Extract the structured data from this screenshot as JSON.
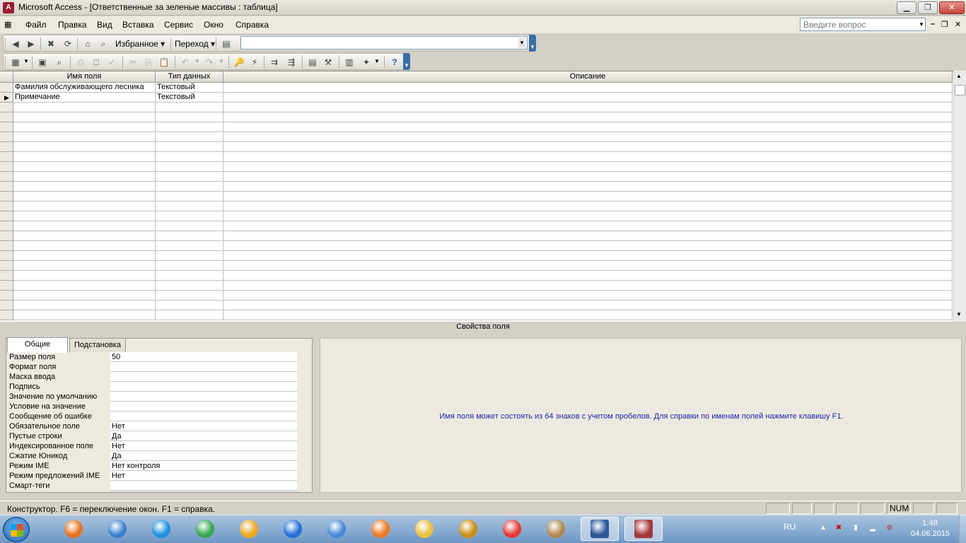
{
  "window": {
    "title": "Microsoft Access - [Ответственные за зеленые массивы : таблица]"
  },
  "menu": {
    "items": [
      "Файл",
      "Правка",
      "Вид",
      "Вставка",
      "Сервис",
      "Окно",
      "Справка"
    ],
    "ask_placeholder": "Введите вопрос"
  },
  "web_toolbar": {
    "favorites": "Избранное",
    "goto": "Переход",
    "address": ""
  },
  "grid": {
    "headers": [
      "Имя поля",
      "Тип данных",
      "Описание"
    ],
    "rows": [
      {
        "name": "Фамилия обслуживающего лесника",
        "type": "Текстовый",
        "desc": ""
      },
      {
        "name": "Примечание",
        "type": "Текстовый",
        "desc": ""
      }
    ],
    "current_row_marker": "▶"
  },
  "properties": {
    "caption": "Свойства поля",
    "tabs": [
      "Общие",
      "Подстановка"
    ],
    "active_tab": "Общие",
    "rows": [
      {
        "label": "Размер поля",
        "value": "50"
      },
      {
        "label": "Формат поля",
        "value": ""
      },
      {
        "label": "Маска ввода",
        "value": ""
      },
      {
        "label": "Подпись",
        "value": ""
      },
      {
        "label": "Значение по умолчанию",
        "value": ""
      },
      {
        "label": "Условие на значение",
        "value": ""
      },
      {
        "label": "Сообщение об ошибке",
        "value": ""
      },
      {
        "label": "Обязательное поле",
        "value": "Нет"
      },
      {
        "label": "Пустые строки",
        "value": "Да"
      },
      {
        "label": "Индексированное поле",
        "value": "Нет"
      },
      {
        "label": "Сжатие Юникод",
        "value": "Да"
      },
      {
        "label": "Режим IME",
        "value": "Нет контроля"
      },
      {
        "label": "Режим предложений IME",
        "value": "Нет"
      },
      {
        "label": "Смарт-теги",
        "value": ""
      }
    ],
    "help": "Имя поля может состоять из 64 знаков с учетом пробелов.  Для справки по именам полей нажмите клавишу F1."
  },
  "status": {
    "text": "Конструктор.  F6 = переключение окон.  F1 = справка.",
    "num": "NUM"
  },
  "taskbar": {
    "language": "RU",
    "time": "1:48",
    "date": "04.06.2015",
    "apps": [
      {
        "icon": "firefox-icon",
        "color": "#e8731f"
      },
      {
        "icon": "speaker-icon",
        "color": "#3b7fd1"
      },
      {
        "icon": "internet-explorer-icon",
        "color": "#1e90e0"
      },
      {
        "icon": "chrome-icon",
        "color": "#34a853"
      },
      {
        "icon": "mail-at-icon",
        "color": "#f0a820"
      },
      {
        "icon": "maxthon-icon",
        "color": "#2370d6"
      },
      {
        "icon": "envelope-icon",
        "color": "#4a8ad8"
      },
      {
        "icon": "media-player-icon",
        "color": "#f07820"
      },
      {
        "icon": "folder-icon",
        "color": "#e8c040"
      },
      {
        "icon": "winamp-icon",
        "color": "#c89010"
      },
      {
        "icon": "yandex-icon",
        "color": "#e53935"
      },
      {
        "icon": "mahjong-icon",
        "color": "#b08850"
      },
      {
        "icon": "word-icon",
        "color": "#2b5797"
      },
      {
        "icon": "access-icon",
        "color": "#a4373a"
      }
    ]
  },
  "colors": {
    "help_text": "#1f1fa8",
    "taskbar": "#6e97c4"
  }
}
